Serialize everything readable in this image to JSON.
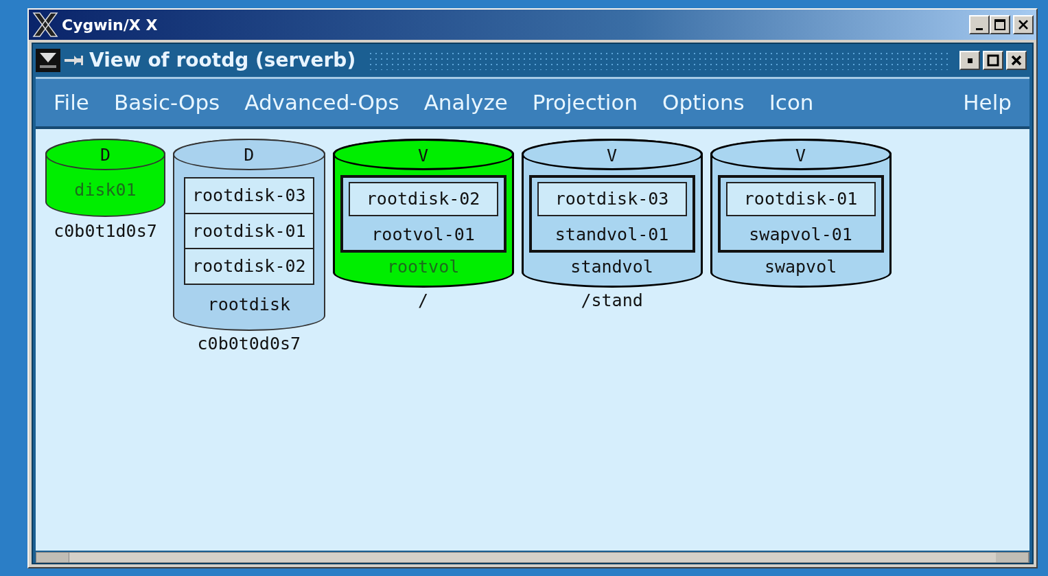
{
  "outer_window": {
    "title": "Cygwin/X X"
  },
  "window": {
    "title": "View of rootdg (serverb)"
  },
  "menu": [
    {
      "label": "File"
    },
    {
      "label": "Basic-Ops"
    },
    {
      "label": "Advanced-Ops"
    },
    {
      "label": "Analyze"
    },
    {
      "label": "Projection"
    },
    {
      "label": "Options"
    },
    {
      "label": "Icon"
    }
  ],
  "help_menu": {
    "label": "Help"
  },
  "objects": [
    {
      "kind": "disk",
      "type": "D",
      "name": "disk01",
      "caption": "c0b0t1d0s7",
      "selected": true
    },
    {
      "kind": "disk",
      "type": "D",
      "name": "rootdisk",
      "caption": "c0b0t0d0s7",
      "selected": false,
      "subdisks": [
        "rootdisk-03",
        "rootdisk-01",
        "rootdisk-02"
      ]
    },
    {
      "kind": "volume",
      "type": "V",
      "name": "rootvol",
      "caption": "/",
      "selected": true,
      "plexes": [
        {
          "name": "rootvol-01",
          "subdisks": [
            "rootdisk-02"
          ]
        }
      ]
    },
    {
      "kind": "volume",
      "type": "V",
      "name": "standvol",
      "caption": "/stand",
      "selected": false,
      "plexes": [
        {
          "name": "standvol-01",
          "subdisks": [
            "rootdisk-03"
          ]
        }
      ]
    },
    {
      "kind": "volume",
      "type": "V",
      "name": "swapvol",
      "selected": false,
      "plexes": [
        {
          "name": "swapvol-01",
          "subdisks": [
            "rootdisk-01"
          ]
        }
      ]
    }
  ]
}
